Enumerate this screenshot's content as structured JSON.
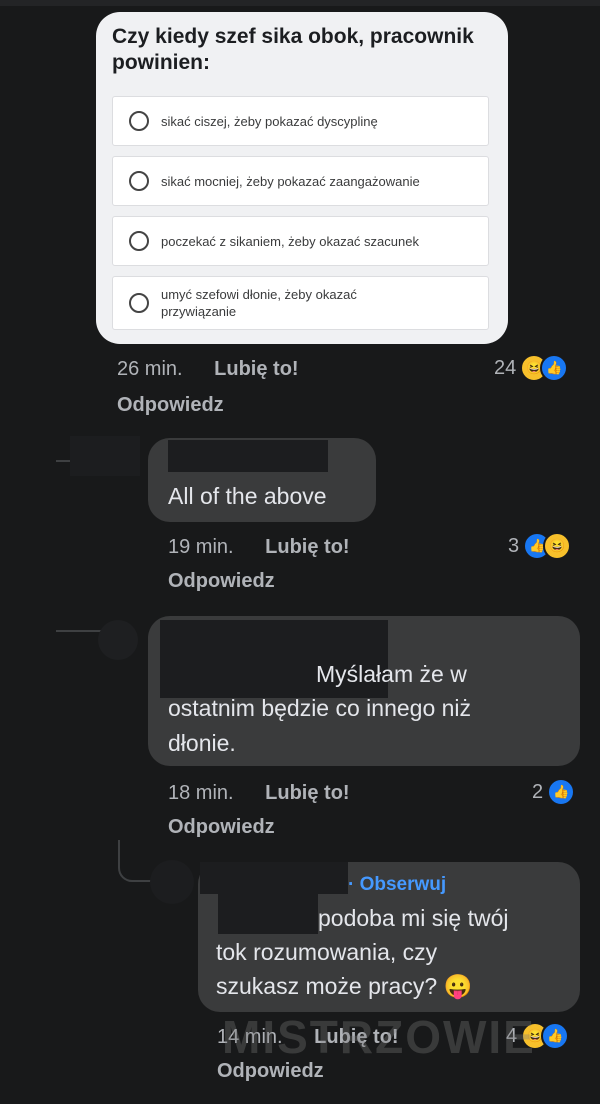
{
  "poll": {
    "question": "Czy kiedy szef sika obok, pracownik powinien:",
    "options": [
      "sikać ciszej, żeby pokazać dyscyplinę",
      "sikać mocniej, żeby pokazać zaangażowanie",
      "poczekać z sikaniem, żeby okazać szacunek",
      "umyć szefowi dłonie, żeby okazać przywiązanie"
    ],
    "meta": {
      "time": "26 min.",
      "like": "Lubię to!",
      "reply": "Odpowiedz",
      "count": "24"
    }
  },
  "comments": [
    {
      "text": "All of the above",
      "time": "19 min.",
      "like": "Lubię to!",
      "reply": "Odpowiedz",
      "count": "3"
    },
    {
      "line1": "Myślałam że w",
      "line2": "ostatnim będzie co innego niż",
      "line3": "dłonie.",
      "time": "18 min.",
      "like": "Lubię to!",
      "reply": "Odpowiedz",
      "count": "2"
    },
    {
      "follow": "· Obserwuj",
      "line1": "podoba mi się twój",
      "line2": "tok rozumowania, czy",
      "line3": "szukasz może pracy? 😛",
      "time": "14 min.",
      "like": "Lubię to!",
      "reply": "Odpowiedz",
      "count": "4"
    }
  ],
  "watermark": "MISTRZOWIE",
  "colors": {
    "background": "#18191a",
    "bubble": "#3a3b3c",
    "link": "#4599ff",
    "like": "#1877f2"
  }
}
